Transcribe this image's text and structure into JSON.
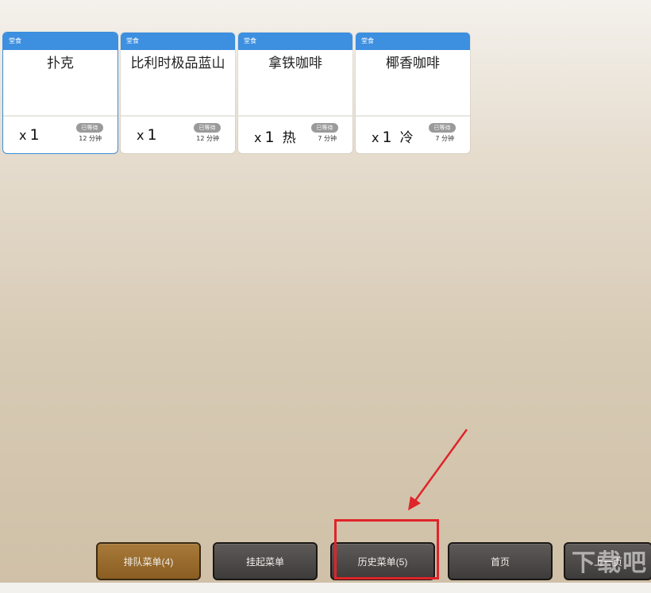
{
  "cards": [
    {
      "order_type": "堂食",
      "name": "扑克",
      "qty_prefix": "x",
      "qty": "1",
      "temp": "",
      "wait_status": "已等待",
      "wait_time": "12 分钟",
      "selected": true
    },
    {
      "order_type": "堂食",
      "name": "比利时极品蓝山",
      "qty_prefix": "x",
      "qty": "1",
      "temp": "",
      "wait_status": "已等待",
      "wait_time": "12 分钟",
      "selected": false
    },
    {
      "order_type": "堂食",
      "name": "拿铁咖啡",
      "qty_prefix": "x",
      "qty": "1",
      "temp": "热",
      "wait_status": "已等待",
      "wait_time": "7 分钟",
      "selected": false
    },
    {
      "order_type": "堂食",
      "name": "椰香咖啡",
      "qty_prefix": "x",
      "qty": "1",
      "temp": "冷",
      "wait_status": "已等待",
      "wait_time": "7 分钟",
      "selected": false
    }
  ],
  "bottom_bar": {
    "queue_menu": "排队菜单(4)",
    "hold_menu": "挂起菜单",
    "history_menu": "历史菜单(5)",
    "home": "首页",
    "prev_page": "上一页"
  },
  "colors": {
    "card_header": "#3d8fe0",
    "active_button": "#9a6b2c",
    "highlight": "#e0242a"
  },
  "watermark": "下载吧"
}
